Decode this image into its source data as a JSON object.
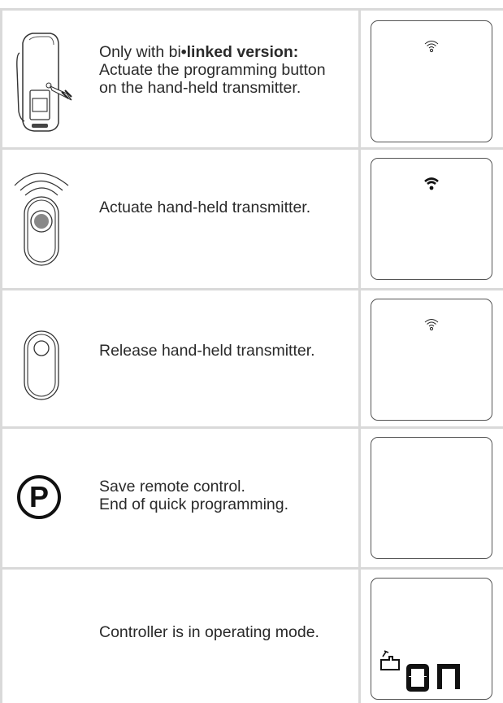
{
  "rows": [
    {
      "text_prefix": "Only with bi",
      "text_bold": "•linked version:",
      "text_rest": "Actuate the programming button on the hand-held transmitter.",
      "icon": "handheld-transmitter-side-icon",
      "display_symbol": "wifi-outline-icon"
    },
    {
      "text": "Actuate hand-held transmitter.",
      "icon": "transmitter-button-pressed-icon",
      "display_symbol": "wifi-solid-icon"
    },
    {
      "text": "Release hand-held transmitter.",
      "icon": "transmitter-button-released-icon",
      "display_symbol": "wifi-outline-icon"
    },
    {
      "text_line1": "Save remote control.",
      "text_line2": "End of quick programming.",
      "icon": "programming-p-icon",
      "display_symbol": ""
    },
    {
      "text": "Controller is in operating mode.",
      "icon": "",
      "display_symbol": "hand-symbol-icon",
      "display_value": "on"
    }
  ]
}
